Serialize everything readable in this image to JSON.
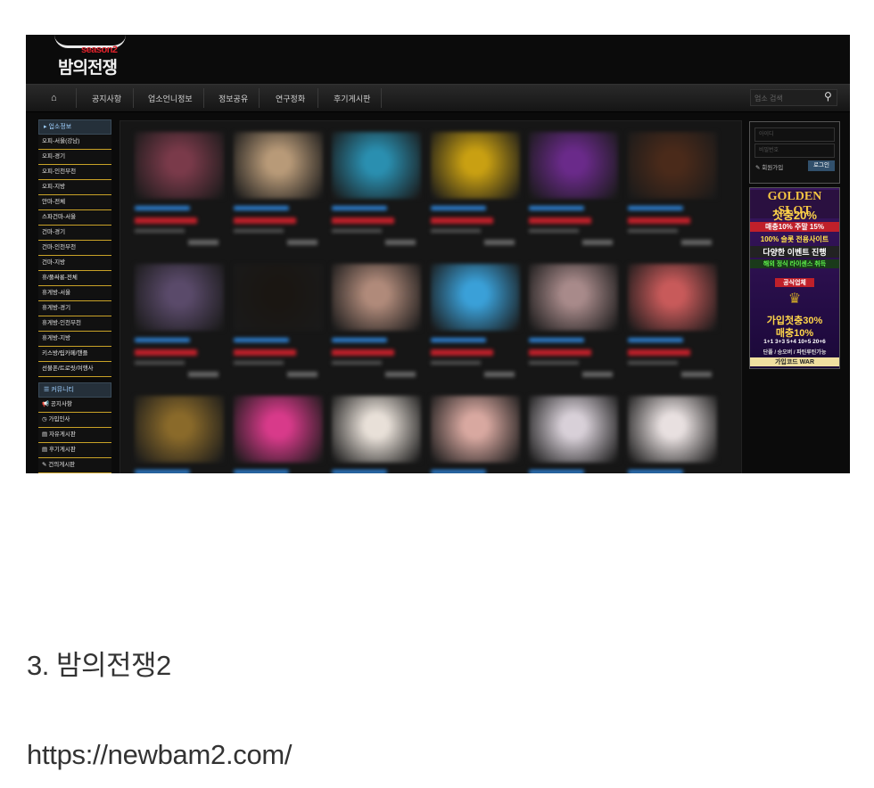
{
  "screenshot": {
    "logo": {
      "season": "season2",
      "name": "밤의전쟁"
    },
    "nav": {
      "items": [
        "공지사항",
        "업소언니정보",
        "정보공유",
        "연구정화",
        "후기게시판"
      ],
      "search_placeholder": "업소 검색"
    },
    "sidebar": {
      "section1": "업소정보",
      "items": [
        "오피-서울(강남)",
        "오피-경기",
        "오피-인천부천",
        "오피-지방",
        "안마-전체",
        "스파건마-서울",
        "건마-경기",
        "건마-인천부천",
        "건마-지방",
        "휴/풀싸롱-전체",
        "휴게방-서울",
        "휴게방-경기",
        "휴게방-인천부천",
        "휴게방-지방",
        "키스방/립카페/핸플",
        "선불폰/트로릿/여행사"
      ],
      "section2": "커뮤니티",
      "items2": [
        "공지사항",
        "가입인사",
        "자유게시판",
        "후기게시판",
        "건의게시판"
      ]
    },
    "login": {
      "id": "아이디",
      "password": "비밀번호",
      "join": "회원가입",
      "button": "로그인"
    },
    "ad": {
      "title": "GOLDEN SLOT",
      "line1": "첫충20%",
      "line2": "매충10% 주말 15%",
      "line3": "100% 슬롯 전용사이트",
      "line4": "다양한 이벤트 진행",
      "line5": "해외 정식 라이센스 취득",
      "badge": "공식업체",
      "line6": "가입첫충30%",
      "line7": "매충10%",
      "line8": "1+1 3+3 5+4 10+5 20+6",
      "line9": "단폴 / 승오버 / 파틴루틴가능",
      "line10": "가입코드 WAR"
    }
  },
  "caption": "3. 밤의전쟁2",
  "url": "https://newbam2.com/",
  "colors": {
    "thumbs": [
      "#7a3a4a",
      "#b89a78",
      "#2a8fb0",
      "#c9a012",
      "#6a2a8a",
      "#4a2a1a",
      "#5a4a6a",
      "#1a1612",
      "#b08a7a",
      "#3aa0d8",
      "#a88a8a",
      "#c85a5a",
      "#8a6a2a",
      "#d83a8a",
      "#e8e0d8",
      "#d8a8a0",
      "#d8d0d8",
      "#e8e0e0"
    ]
  }
}
